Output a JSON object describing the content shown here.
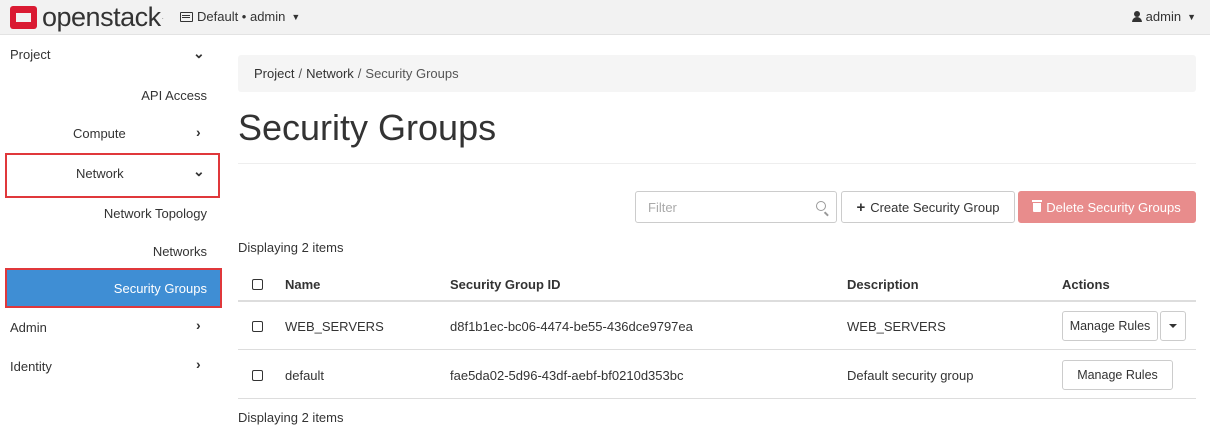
{
  "topbar": {
    "logo_text": "openstack",
    "logo_dot": ".",
    "context_label": "Default • admin",
    "user_label": "admin"
  },
  "sidebar": {
    "project": "Project",
    "api_access": "API Access",
    "compute": "Compute",
    "network": "Network",
    "network_topology": "Network Topology",
    "networks": "Networks",
    "security_groups": "Security Groups",
    "admin": "Admin",
    "identity": "Identity"
  },
  "breadcrumb": {
    "items": [
      "Project",
      "Network",
      "Security Groups"
    ],
    "separator": "/"
  },
  "page": {
    "title": "Security Groups"
  },
  "toolbar": {
    "filter_placeholder": "Filter",
    "create_label": "Create Security Group",
    "delete_label": "Delete Security Groups"
  },
  "table": {
    "count_label": "Displaying 2 items",
    "columns": [
      "Name",
      "Security Group ID",
      "Description",
      "Actions"
    ],
    "rows": [
      {
        "name": "WEB_SERVERS",
        "id": "d8f1b1ec-bc06-4474-be55-436dce9797ea",
        "description": "WEB_SERVERS",
        "action": "Manage Rules"
      },
      {
        "name": "default",
        "id": "fae5da02-5d96-43df-aebf-bf0210d353bc",
        "description": "Default security group",
        "action": "Manage Rules"
      }
    ]
  },
  "colors": {
    "active_nav": "#3f8ed4",
    "highlight_box": "#e0383b",
    "delete_button": "#e88c8c",
    "logo_red": "#da1a32"
  }
}
